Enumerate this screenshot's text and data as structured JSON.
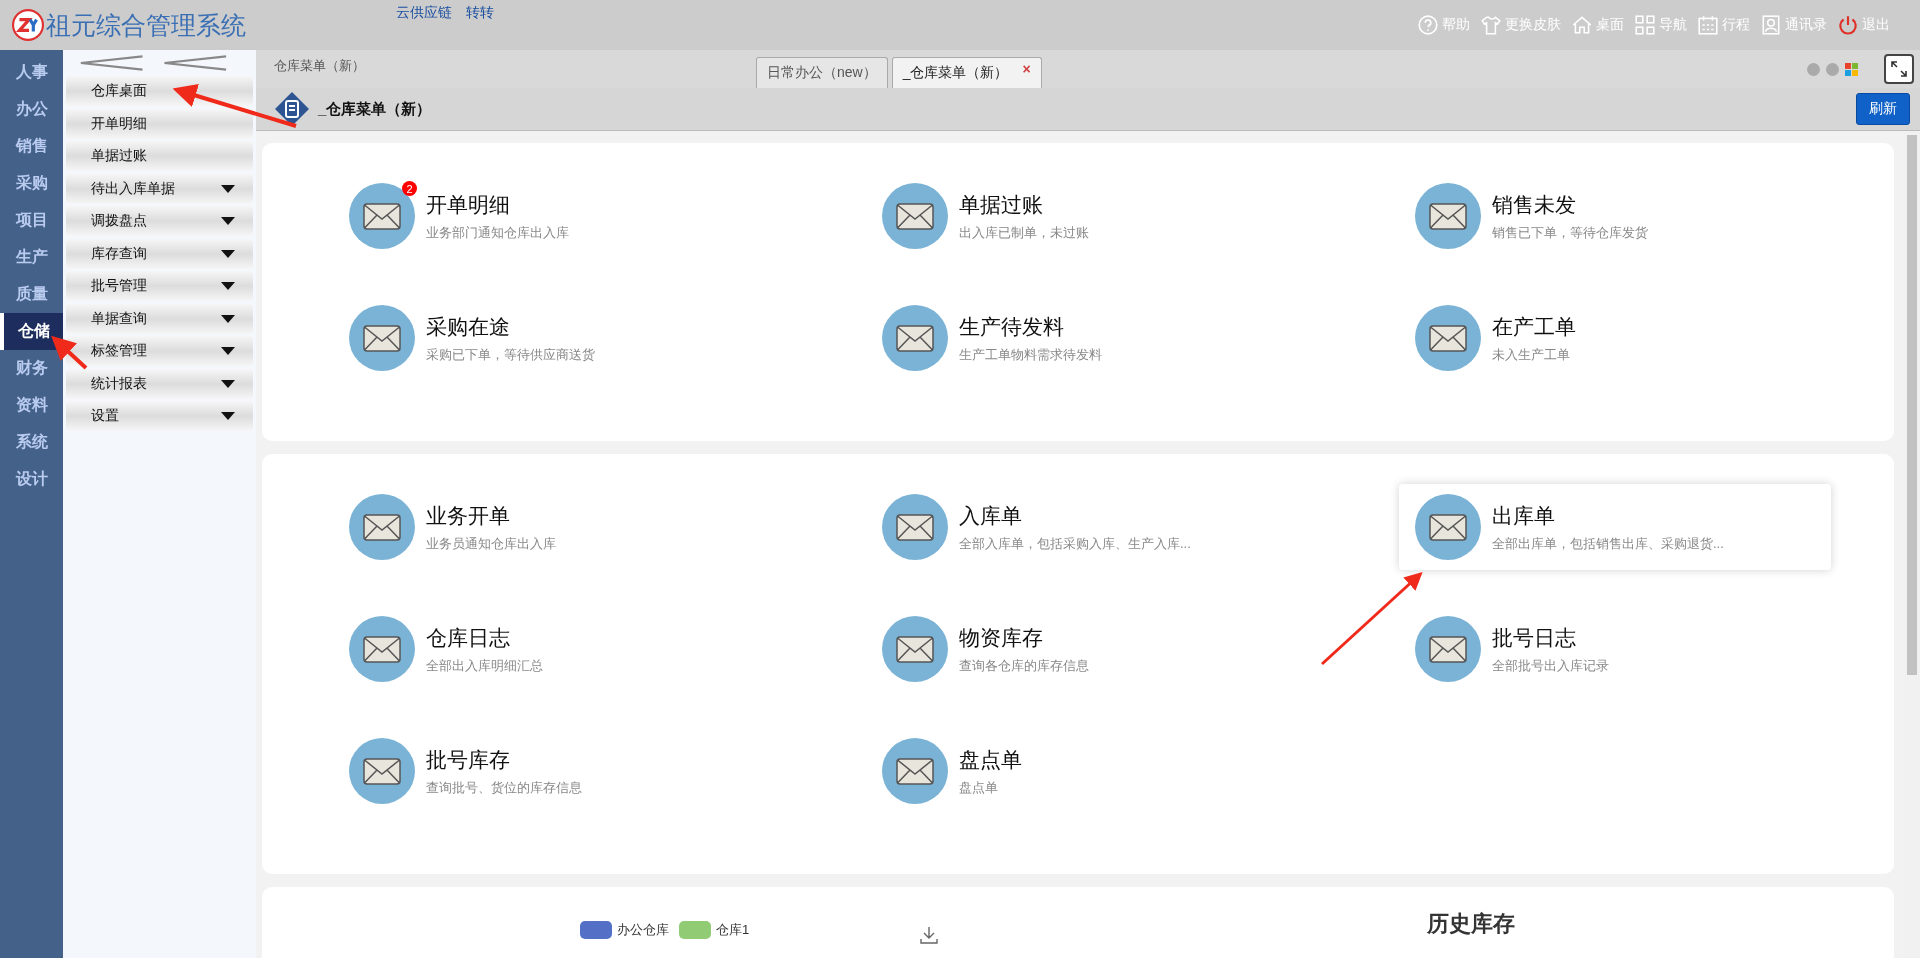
{
  "header": {
    "title": "祖元综合管理系统",
    "links": [
      "云供应链",
      "转转"
    ],
    "actions": [
      {
        "kind": "help",
        "label": "帮助"
      },
      {
        "kind": "shirt",
        "label": "更换皮肤"
      },
      {
        "kind": "home",
        "label": "桌面"
      },
      {
        "kind": "grid",
        "label": "导航"
      },
      {
        "kind": "calendar",
        "label": "行程"
      },
      {
        "kind": "contact",
        "label": "通讯录"
      },
      {
        "kind": "power",
        "label": "退出"
      }
    ]
  },
  "modules": [
    {
      "label": "人事",
      "selected": false
    },
    {
      "label": "办公",
      "selected": false
    },
    {
      "label": "销售",
      "selected": false
    },
    {
      "label": "采购",
      "selected": false
    },
    {
      "label": "项目",
      "selected": false
    },
    {
      "label": "生产",
      "selected": false
    },
    {
      "label": "质量",
      "selected": false
    },
    {
      "label": "仓储",
      "selected": true
    },
    {
      "label": "财务",
      "selected": false
    },
    {
      "label": "资料",
      "selected": false
    },
    {
      "label": "系统",
      "selected": false
    },
    {
      "label": "设计",
      "selected": false
    }
  ],
  "sidebar": {
    "items": [
      {
        "label": "仓库桌面",
        "expandable": false
      },
      {
        "label": "开单明细",
        "expandable": false
      },
      {
        "label": "单据过账",
        "expandable": false
      },
      {
        "label": "待出入库单据",
        "expandable": true
      },
      {
        "label": "调拨盘点",
        "expandable": true
      },
      {
        "label": "库存查询",
        "expandable": true
      },
      {
        "label": "批号管理",
        "expandable": true
      },
      {
        "label": "单据查询",
        "expandable": true
      },
      {
        "label": "标签管理",
        "expandable": true
      },
      {
        "label": "统计报表",
        "expandable": true
      },
      {
        "label": "设置",
        "expandable": true
      }
    ]
  },
  "breadcrumb": "仓库菜单（新）",
  "tabs": [
    {
      "label": "日常办公（new）",
      "selected": false,
      "closable": false
    },
    {
      "label": "_仓库菜单（新）",
      "selected": true,
      "closable": true,
      "close": "×"
    }
  ],
  "page": {
    "title": "_仓库菜单（新）",
    "refresh": "刷新"
  },
  "cards": [
    {
      "items": [
        {
          "title": "开单明细",
          "desc": "业务部门通知仓库出入库",
          "badge": "2",
          "highlighted": false
        },
        {
          "title": "单据过账",
          "desc": "出入库已制单，未过账",
          "highlighted": false
        },
        {
          "title": "销售未发",
          "desc": "销售已下单，等待仓库发货",
          "highlighted": false
        },
        {
          "title": "采购在途",
          "desc": "采购已下单，等待供应商送货",
          "highlighted": false
        },
        {
          "title": "生产待发料",
          "desc": "生产工单物料需求待发料",
          "highlighted": false
        },
        {
          "title": "在产工单",
          "desc": "未入生产工单",
          "highlighted": false
        }
      ]
    },
    {
      "items": [
        {
          "title": "业务开单",
          "desc": "业务员通知仓库出入库",
          "highlighted": false
        },
        {
          "title": "入库单",
          "desc": "全部入库单，包括采购入库、生产入库...",
          "highlighted": false
        },
        {
          "title": "出库单",
          "desc": "全部出库单，包括销售出库、采购退货...",
          "highlighted": true
        },
        {
          "title": "仓库日志",
          "desc": "全部出入库明细汇总",
          "highlighted": false
        },
        {
          "title": "物资库存",
          "desc": "查询各仓库的库存信息",
          "highlighted": false
        },
        {
          "title": "批号日志",
          "desc": "全部批号出入库记录",
          "highlighted": false
        },
        {
          "title": "批号库存",
          "desc": "查询批号、货位的库存信息",
          "highlighted": false
        },
        {
          "title": "盘点单",
          "desc": "盘点单",
          "highlighted": false
        }
      ]
    }
  ],
  "history": {
    "title": "历史库存",
    "legend": [
      {
        "label": "办公仓库",
        "color": "#5470c6"
      },
      {
        "label": "仓库1",
        "color": "#91cc75"
      }
    ]
  }
}
